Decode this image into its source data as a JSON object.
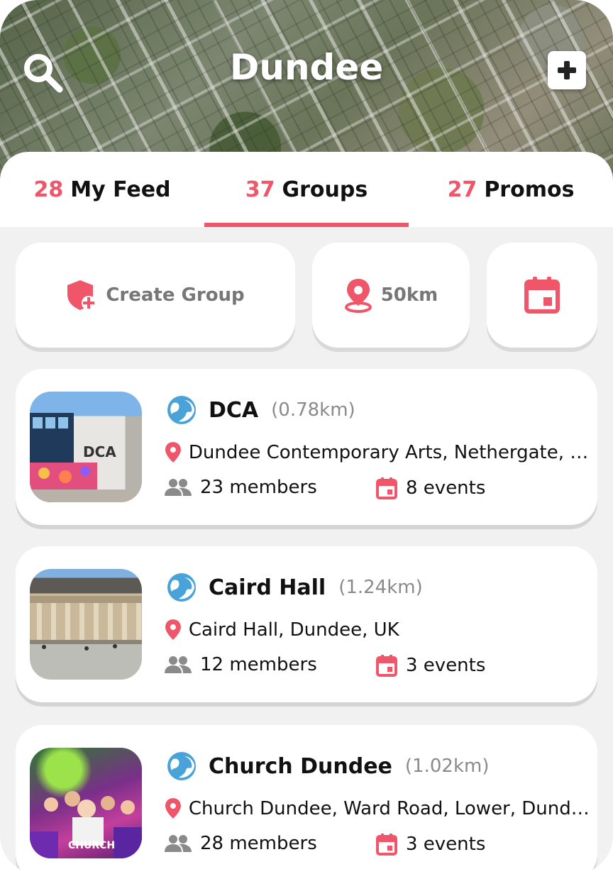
{
  "header": {
    "city": "Dundee",
    "search_icon": "search-icon",
    "add_icon": "add-square-icon"
  },
  "tabs": [
    {
      "count": "28",
      "label": "My Feed",
      "active": false
    },
    {
      "count": "37",
      "label": "Groups",
      "active": true
    },
    {
      "count": "27",
      "label": "Promos",
      "active": false
    }
  ],
  "filters": {
    "create_group_label": "Create Group",
    "distance_label": "50km",
    "calendar_icon": "calendar-icon"
  },
  "groups": [
    {
      "name": "DCA",
      "distance": "(0.78km)",
      "address": "Dundee Contemporary Arts, Nethergate, Dundee, UK",
      "members": "23 members",
      "events": "8 events"
    },
    {
      "name": "Caird Hall",
      "distance": "(1.24km)",
      "address": "Caird Hall, Dundee, UK",
      "members": "12 members",
      "events": "3 events"
    },
    {
      "name": "Church Dundee",
      "distance": "(1.02km)",
      "address": "Church Dundee, Ward Road, Lower, Dundee, UK",
      "members": "28 members",
      "events": "3 events",
      "thumb_text": "CHURCH"
    }
  ],
  "colors": {
    "accent": "#f0566a",
    "globe": "#4aa3d8"
  }
}
